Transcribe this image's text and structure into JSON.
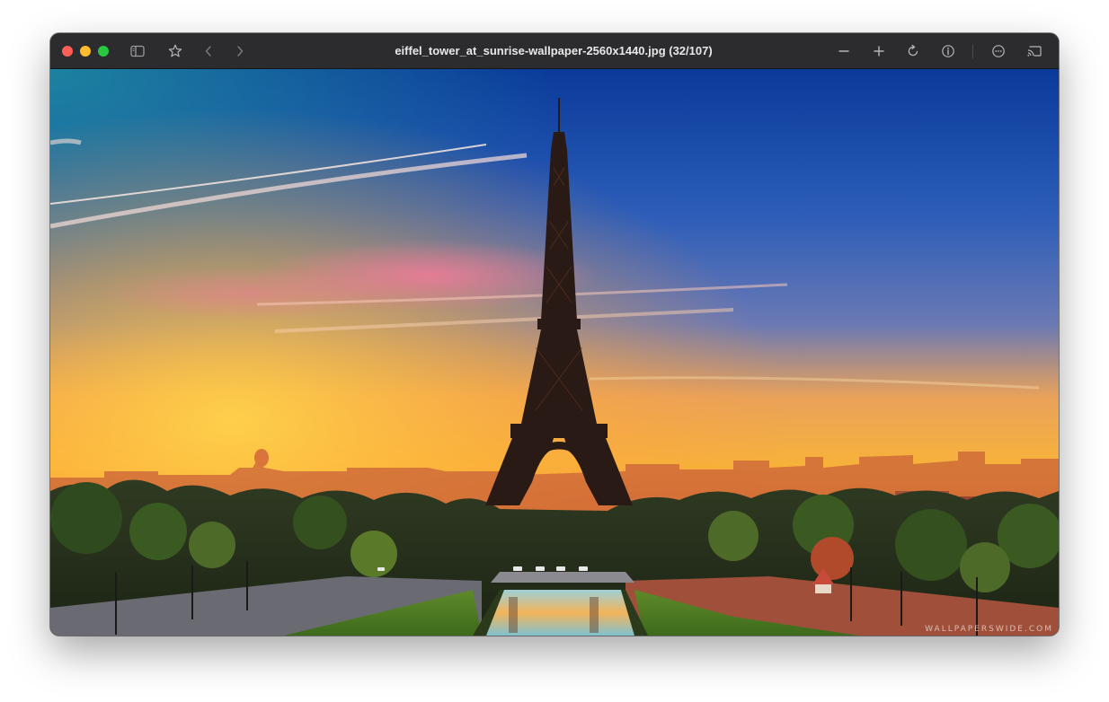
{
  "window": {
    "title": "eiffel_tower_at_sunrise-wallpaper-2560x1440.jpg (32/107)"
  },
  "toolbar": {
    "left_icons": [
      "sidebar-icon",
      "star-icon",
      "chevron-left-icon",
      "chevron-right-icon"
    ],
    "right_icons": [
      "zoom-out-icon",
      "zoom-in-icon",
      "rotate-icon",
      "info-icon",
      "more-icon",
      "airplay-icon"
    ]
  },
  "image": {
    "filename": "eiffel_tower_at_sunrise-wallpaper-2560x1440.jpg",
    "index": 32,
    "total": 107,
    "watermark": "WALLPAPERSWIDE.COM"
  },
  "colors": {
    "titlebar": "#2c2c2e",
    "close": "#ff5f57",
    "minimize": "#febc2e",
    "maximize": "#28c840"
  }
}
